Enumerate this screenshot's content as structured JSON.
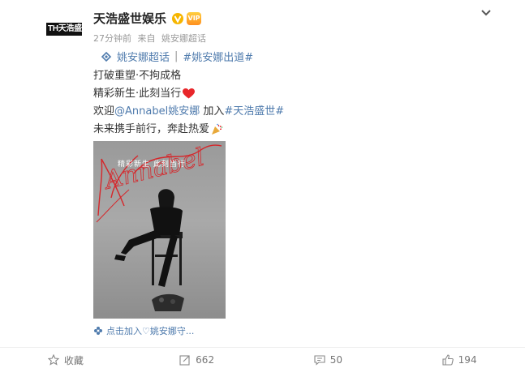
{
  "post": {
    "avatar_text": "TH天浩盛世",
    "username": "天浩盛世娱乐",
    "vip_badge": "VIP",
    "time": "27分钟前",
    "source_prefix": "来自",
    "source": "姚安娜超话",
    "topic_supertopic": "姚安娜超话",
    "topic_separator": "|",
    "topic_hashtag": "#姚安娜出道#",
    "line1": "打破重塑·不拘成格",
    "line2": "精彩新生·此刻当行",
    "line3_prefix": "欢迎",
    "line3_mention": "@Annabel姚安娜",
    "line3_middle": " 加入",
    "line3_hashtag": "#天浩盛世#",
    "line4": "未来携手前行，奔赴热爱",
    "photo_script": "Annabel",
    "photo_caption": "精彩新生  此刻当行",
    "supertopic_link": "点击加入♡姚安娜守..."
  },
  "actions": {
    "favorite": "收藏",
    "repost": "662",
    "comment": "50",
    "like": "194"
  },
  "colors": {
    "link": "#4f7bad",
    "verified": "#f6b600",
    "heart": "#e8262a"
  }
}
